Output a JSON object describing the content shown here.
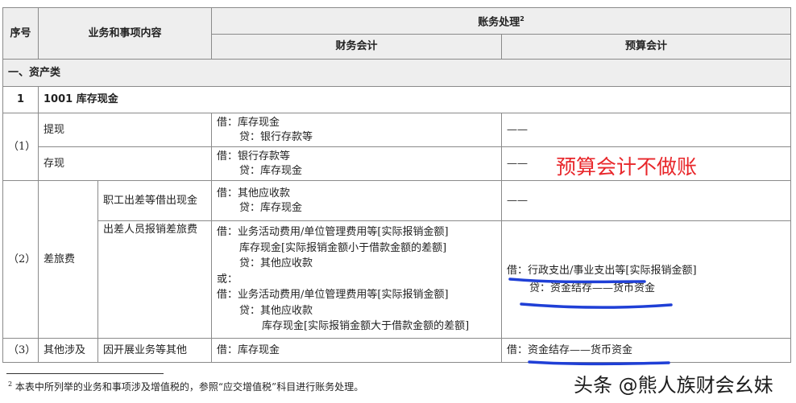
{
  "header": {
    "no": "序号",
    "content": "业务和事项内容",
    "accounting": "账务处理",
    "accounting_sup": "2",
    "financial": "财务会计",
    "budget": "预算会计"
  },
  "section": "一、资产类",
  "account": {
    "no": "1",
    "name": "1001 库存现金"
  },
  "rows": {
    "r1": {
      "no": "（1）",
      "withdraw": {
        "label": "提现",
        "fin": [
          "借：库存现金",
          "贷：银行存款等"
        ],
        "budget": "——"
      },
      "deposit": {
        "label": "存现",
        "fin": [
          "借：银行存款等",
          "贷：库存现金"
        ],
        "budget": "——"
      }
    },
    "r2": {
      "no": "（2）",
      "category": "差旅费",
      "advance": {
        "label": "职工出差等借出现金",
        "fin": [
          "借：其他应收款",
          "贷：库存现金"
        ],
        "budget": "——"
      },
      "reimburse": {
        "label": "出差人员报销差旅费",
        "fin": [
          "借：业务活动费用/单位管理费用等[实际报销金额]",
          "库存现金[实际报销金额小于借款金额的差额]",
          "贷：其他应收款",
          "或：",
          "借：业务活动费用/单位管理费用等[实际报销金额]",
          "贷：其他应收款",
          "库存现金[实际报销金额大于借款金额的差额]"
        ],
        "budget": [
          "借：行政支出/事业支出等[实际报销金额]",
          "贷：资金结存——货币资金"
        ]
      }
    },
    "r3": {
      "no": "（3）",
      "category": "其他涉及",
      "item": {
        "label": "因开展业务等其他",
        "fin": [
          "借：库存现金"
        ],
        "budget": [
          "借：资金结存——货币资金"
        ]
      }
    }
  },
  "annotation": "预算会计不做账",
  "footnote": {
    "mark": "2",
    "text": "本表中所列举的业务和事项涉及增值税的，参照“应交增值税”科目进行账务处理。"
  },
  "watermark": "头条 @熊人族财会幺妹",
  "colors": {
    "annotation": "#e8262a",
    "pen": "#1f3fd6",
    "header_bg": "#eeeeee"
  }
}
